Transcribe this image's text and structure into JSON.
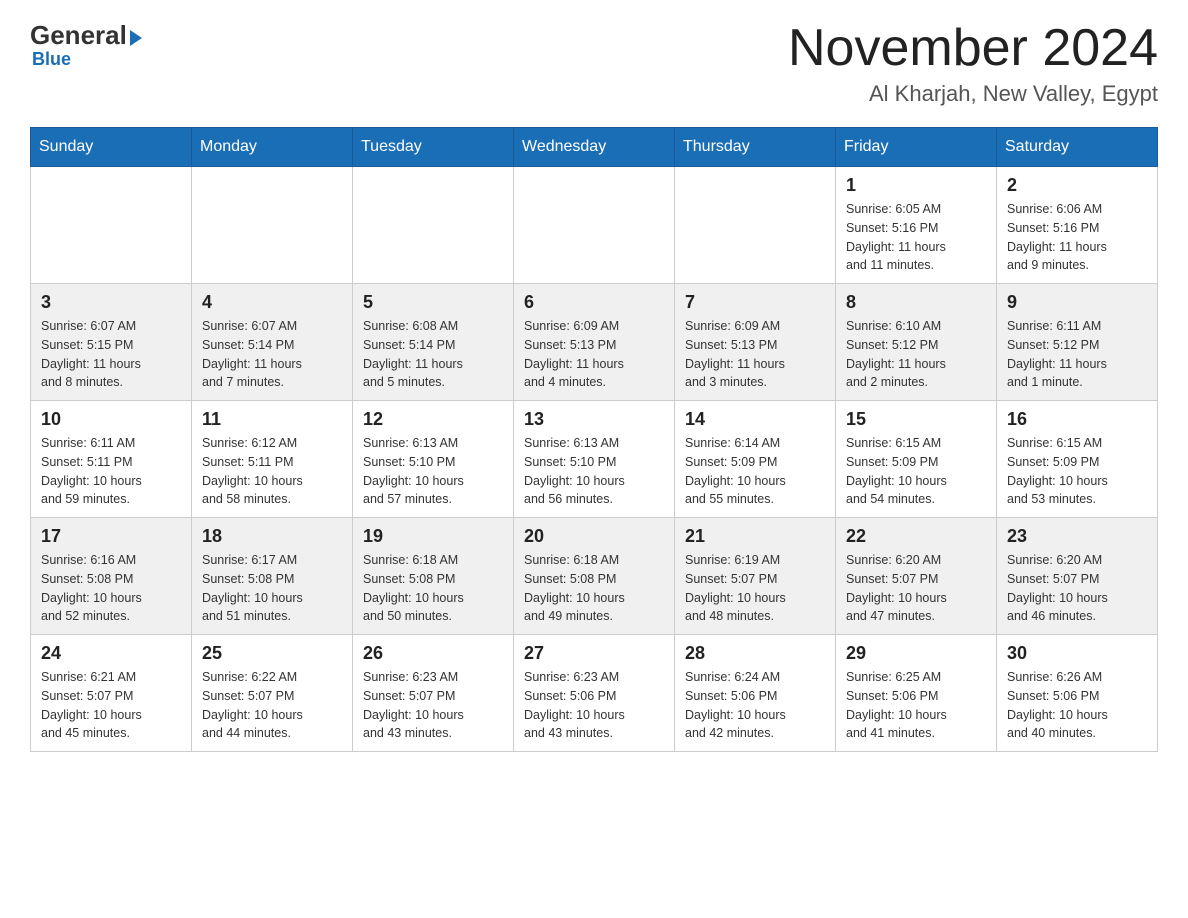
{
  "header": {
    "logo_general": "General",
    "logo_blue": "Blue",
    "logo_subtitle": "Blue",
    "main_title": "November 2024",
    "subtitle": "Al Kharjah, New Valley, Egypt"
  },
  "days_of_week": [
    "Sunday",
    "Monday",
    "Tuesday",
    "Wednesday",
    "Thursday",
    "Friday",
    "Saturday"
  ],
  "weeks": [
    {
      "id": "week1",
      "cells": [
        {
          "day": "",
          "info": ""
        },
        {
          "day": "",
          "info": ""
        },
        {
          "day": "",
          "info": ""
        },
        {
          "day": "",
          "info": ""
        },
        {
          "day": "",
          "info": ""
        },
        {
          "day": "1",
          "info": "Sunrise: 6:05 AM\nSunset: 5:16 PM\nDaylight: 11 hours\nand 11 minutes."
        },
        {
          "day": "2",
          "info": "Sunrise: 6:06 AM\nSunset: 5:16 PM\nDaylight: 11 hours\nand 9 minutes."
        }
      ]
    },
    {
      "id": "week2",
      "cells": [
        {
          "day": "3",
          "info": "Sunrise: 6:07 AM\nSunset: 5:15 PM\nDaylight: 11 hours\nand 8 minutes."
        },
        {
          "day": "4",
          "info": "Sunrise: 6:07 AM\nSunset: 5:14 PM\nDaylight: 11 hours\nand 7 minutes."
        },
        {
          "day": "5",
          "info": "Sunrise: 6:08 AM\nSunset: 5:14 PM\nDaylight: 11 hours\nand 5 minutes."
        },
        {
          "day": "6",
          "info": "Sunrise: 6:09 AM\nSunset: 5:13 PM\nDaylight: 11 hours\nand 4 minutes."
        },
        {
          "day": "7",
          "info": "Sunrise: 6:09 AM\nSunset: 5:13 PM\nDaylight: 11 hours\nand 3 minutes."
        },
        {
          "day": "8",
          "info": "Sunrise: 6:10 AM\nSunset: 5:12 PM\nDaylight: 11 hours\nand 2 minutes."
        },
        {
          "day": "9",
          "info": "Sunrise: 6:11 AM\nSunset: 5:12 PM\nDaylight: 11 hours\nand 1 minute."
        }
      ]
    },
    {
      "id": "week3",
      "cells": [
        {
          "day": "10",
          "info": "Sunrise: 6:11 AM\nSunset: 5:11 PM\nDaylight: 10 hours\nand 59 minutes."
        },
        {
          "day": "11",
          "info": "Sunrise: 6:12 AM\nSunset: 5:11 PM\nDaylight: 10 hours\nand 58 minutes."
        },
        {
          "day": "12",
          "info": "Sunrise: 6:13 AM\nSunset: 5:10 PM\nDaylight: 10 hours\nand 57 minutes."
        },
        {
          "day": "13",
          "info": "Sunrise: 6:13 AM\nSunset: 5:10 PM\nDaylight: 10 hours\nand 56 minutes."
        },
        {
          "day": "14",
          "info": "Sunrise: 6:14 AM\nSunset: 5:09 PM\nDaylight: 10 hours\nand 55 minutes."
        },
        {
          "day": "15",
          "info": "Sunrise: 6:15 AM\nSunset: 5:09 PM\nDaylight: 10 hours\nand 54 minutes."
        },
        {
          "day": "16",
          "info": "Sunrise: 6:15 AM\nSunset: 5:09 PM\nDaylight: 10 hours\nand 53 minutes."
        }
      ]
    },
    {
      "id": "week4",
      "cells": [
        {
          "day": "17",
          "info": "Sunrise: 6:16 AM\nSunset: 5:08 PM\nDaylight: 10 hours\nand 52 minutes."
        },
        {
          "day": "18",
          "info": "Sunrise: 6:17 AM\nSunset: 5:08 PM\nDaylight: 10 hours\nand 51 minutes."
        },
        {
          "day": "19",
          "info": "Sunrise: 6:18 AM\nSunset: 5:08 PM\nDaylight: 10 hours\nand 50 minutes."
        },
        {
          "day": "20",
          "info": "Sunrise: 6:18 AM\nSunset: 5:08 PM\nDaylight: 10 hours\nand 49 minutes."
        },
        {
          "day": "21",
          "info": "Sunrise: 6:19 AM\nSunset: 5:07 PM\nDaylight: 10 hours\nand 48 minutes."
        },
        {
          "day": "22",
          "info": "Sunrise: 6:20 AM\nSunset: 5:07 PM\nDaylight: 10 hours\nand 47 minutes."
        },
        {
          "day": "23",
          "info": "Sunrise: 6:20 AM\nSunset: 5:07 PM\nDaylight: 10 hours\nand 46 minutes."
        }
      ]
    },
    {
      "id": "week5",
      "cells": [
        {
          "day": "24",
          "info": "Sunrise: 6:21 AM\nSunset: 5:07 PM\nDaylight: 10 hours\nand 45 minutes."
        },
        {
          "day": "25",
          "info": "Sunrise: 6:22 AM\nSunset: 5:07 PM\nDaylight: 10 hours\nand 44 minutes."
        },
        {
          "day": "26",
          "info": "Sunrise: 6:23 AM\nSunset: 5:07 PM\nDaylight: 10 hours\nand 43 minutes."
        },
        {
          "day": "27",
          "info": "Sunrise: 6:23 AM\nSunset: 5:06 PM\nDaylight: 10 hours\nand 43 minutes."
        },
        {
          "day": "28",
          "info": "Sunrise: 6:24 AM\nSunset: 5:06 PM\nDaylight: 10 hours\nand 42 minutes."
        },
        {
          "day": "29",
          "info": "Sunrise: 6:25 AM\nSunset: 5:06 PM\nDaylight: 10 hours\nand 41 minutes."
        },
        {
          "day": "30",
          "info": "Sunrise: 6:26 AM\nSunset: 5:06 PM\nDaylight: 10 hours\nand 40 minutes."
        }
      ]
    }
  ]
}
